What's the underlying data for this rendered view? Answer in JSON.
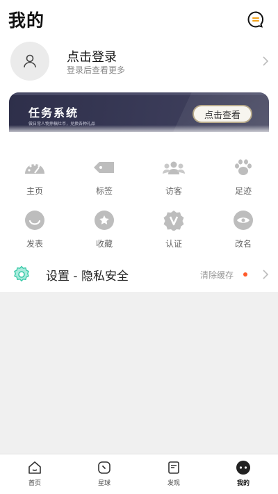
{
  "header": {
    "title": "我的",
    "message_icon": "chat-bubble-icon"
  },
  "login": {
    "title": "点击登录",
    "subtitle": "登录后查看更多"
  },
  "task_banner": {
    "title": "任务系统",
    "subtitle": "做日常人物挣稿吐币，兑换各种礼品",
    "button_label": "点击查看"
  },
  "grid": [
    {
      "label": "主页",
      "icon": "dashboard-icon"
    },
    {
      "label": "标签",
      "icon": "tag-icon"
    },
    {
      "label": "访客",
      "icon": "visitors-icon"
    },
    {
      "label": "足迹",
      "icon": "paw-icon"
    },
    {
      "label": "发表",
      "icon": "smile-icon"
    },
    {
      "label": "收藏",
      "icon": "star-icon"
    },
    {
      "label": "认证",
      "icon": "verified-icon"
    },
    {
      "label": "改名",
      "icon": "rename-icon"
    }
  ],
  "settings": {
    "label": "设置 - 隐私安全",
    "cache_label": "清除缓存",
    "accent": "#39c9a8"
  },
  "tabbar": [
    {
      "label": "首页",
      "icon": "home-icon",
      "active": false
    },
    {
      "label": "星球",
      "icon": "planet-icon",
      "active": false
    },
    {
      "label": "发现",
      "icon": "discover-icon",
      "active": false
    },
    {
      "label": "我的",
      "icon": "profile-icon",
      "active": true
    }
  ]
}
